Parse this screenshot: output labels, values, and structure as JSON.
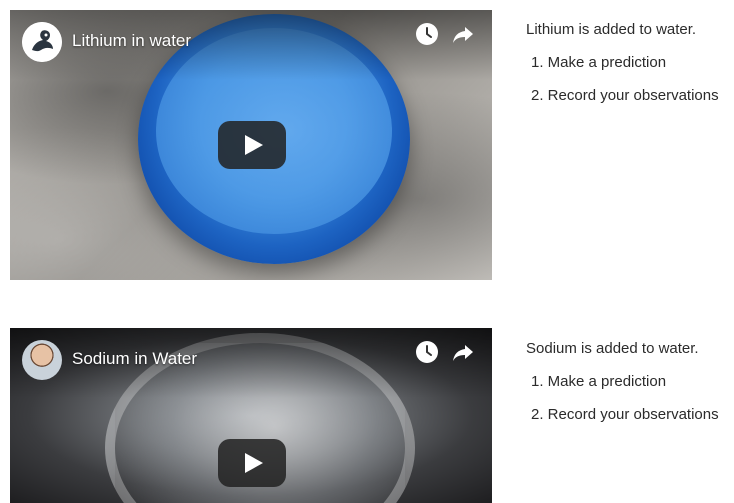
{
  "videos": [
    {
      "title": "Lithium in water",
      "thumbnail": "blue-bucket",
      "avatar": "squirrel-logo",
      "controls": [
        "clock-icon",
        "share-icon"
      ],
      "play_icon": "play-icon"
    },
    {
      "title": "Sodium in Water",
      "thumbnail": "glass-beaker",
      "avatar": "presenter-photo",
      "controls": [
        "clock-icon",
        "share-icon"
      ],
      "play_icon": "play-icon"
    }
  ],
  "sections": [
    {
      "intro": "Lithium is added to water.",
      "steps": [
        "1. Make a prediction",
        "2. Record your observations"
      ]
    },
    {
      "intro": "Sodium is added to water.",
      "steps": [
        "1. Make a prediction",
        "2. Record your observations"
      ]
    }
  ],
  "colors": {
    "play_button_bg": "#212121",
    "bucket_blue": "#1d63c2",
    "text": "#2b2b2b"
  }
}
